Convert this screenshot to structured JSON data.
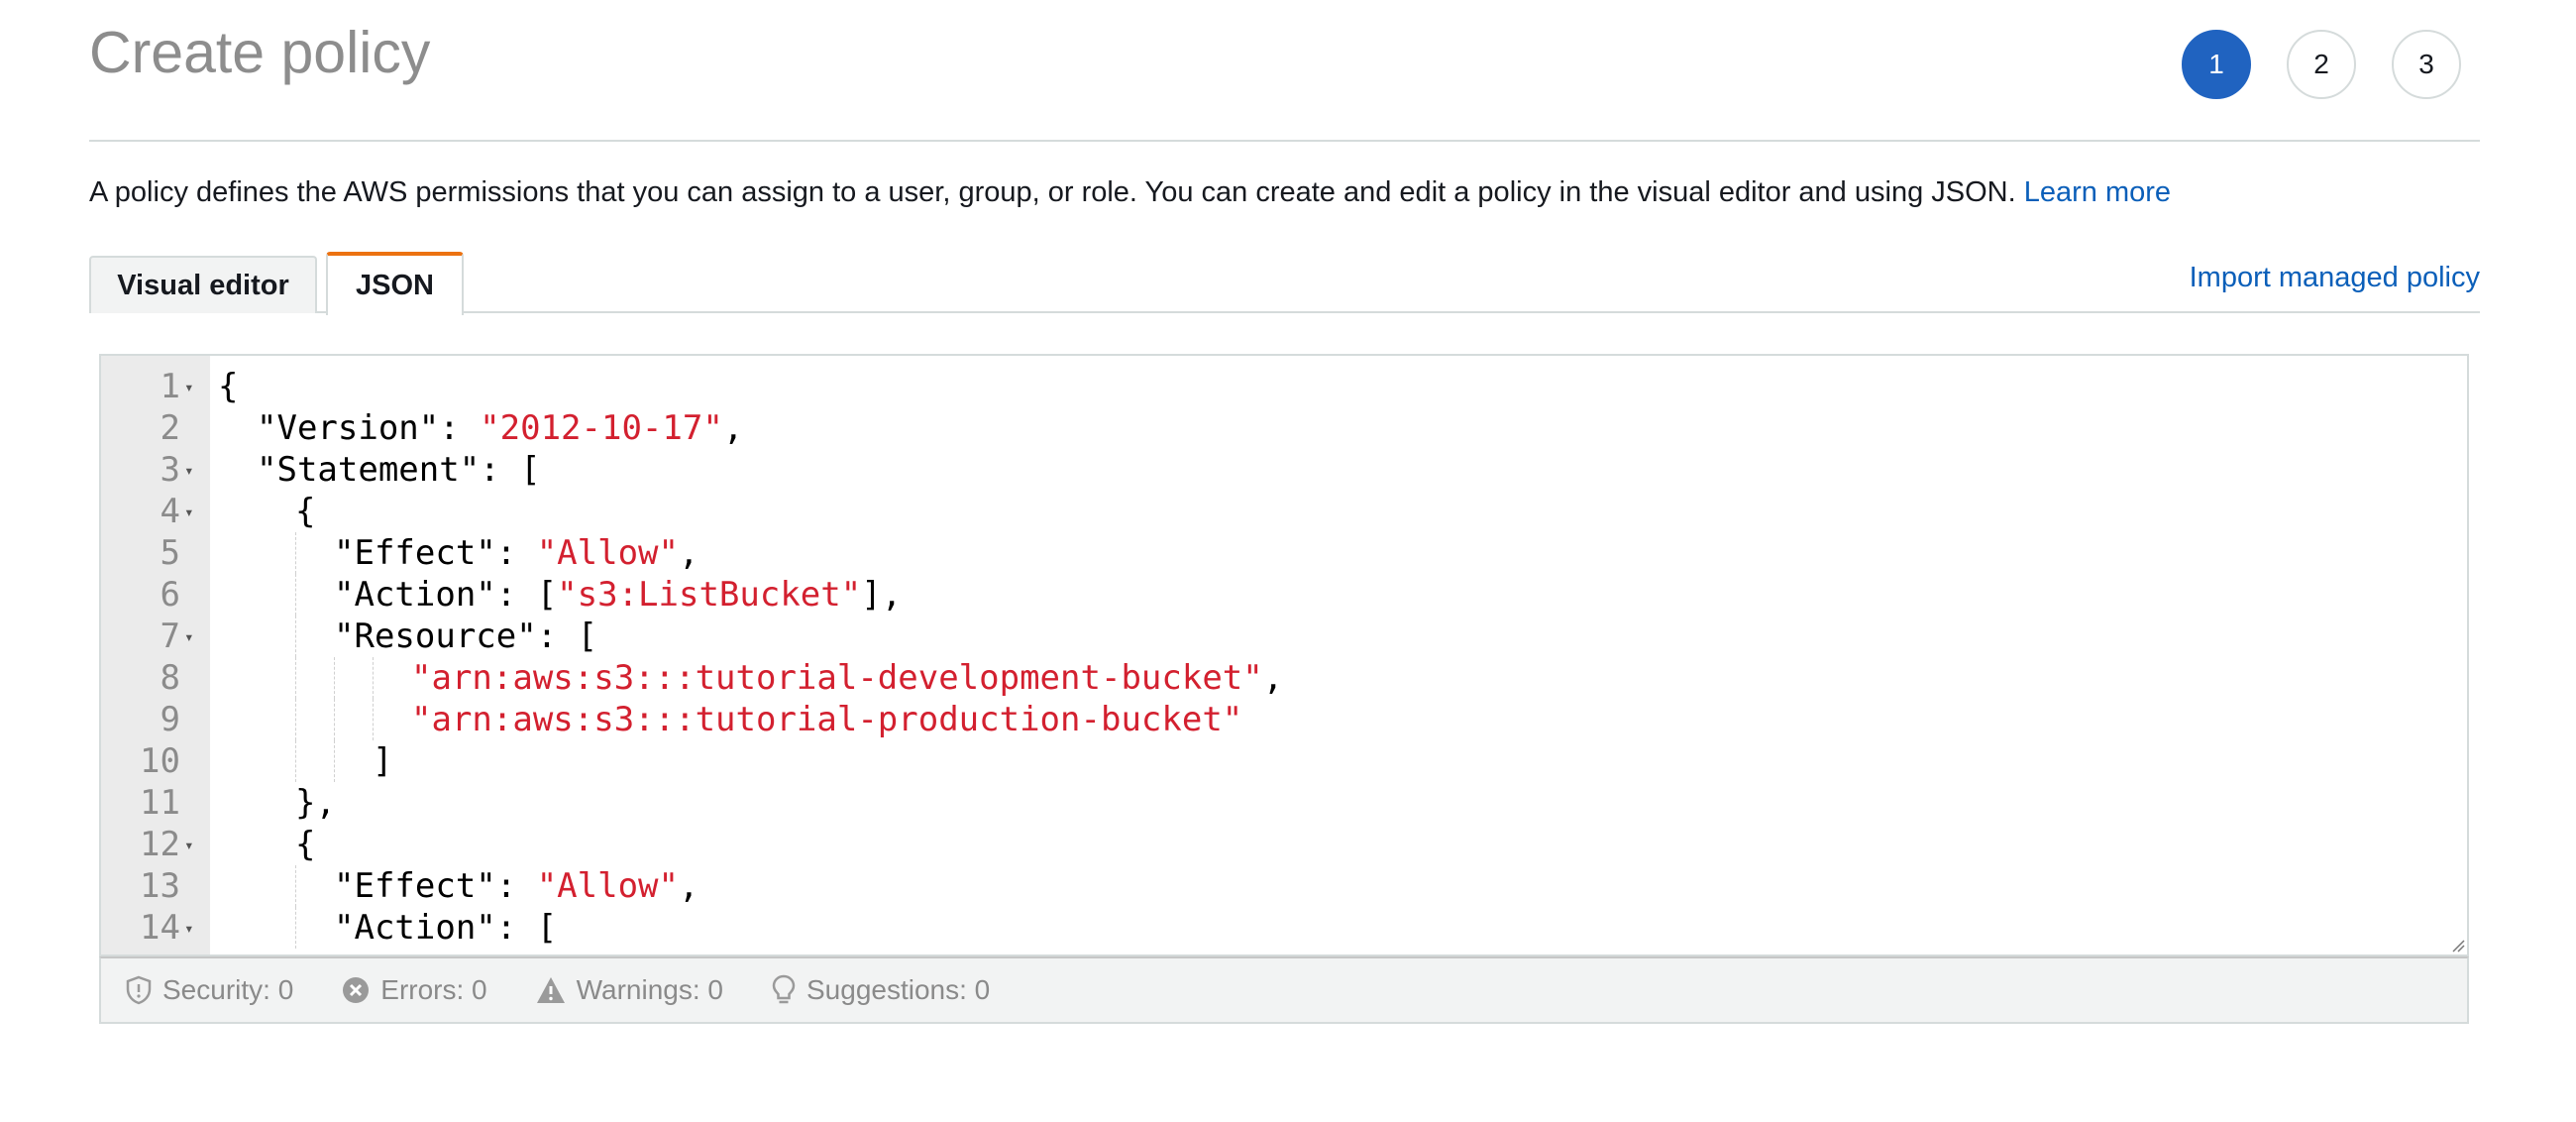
{
  "page": {
    "title": "Create policy",
    "steps": [
      "1",
      "2",
      "3"
    ],
    "active_step": "1"
  },
  "description": {
    "text": "A policy defines the AWS permissions that you can assign to a user, group, or role. You can create and edit a policy in the visual editor and using JSON. ",
    "learn_more": "Learn more"
  },
  "tabs": {
    "visual_editor": "Visual editor",
    "json": "JSON",
    "active": "JSON"
  },
  "import_link": "Import managed policy",
  "editor": {
    "lines": [
      {
        "n": "1",
        "fold": true,
        "indent": 0,
        "parts": [
          {
            "t": "{",
            "s": false
          }
        ]
      },
      {
        "n": "2",
        "fold": false,
        "indent": 1,
        "parts": [
          {
            "t": "\"Version\": ",
            "s": false
          },
          {
            "t": "\"2012-10-17\"",
            "s": true
          },
          {
            "t": ",",
            "s": false
          }
        ]
      },
      {
        "n": "3",
        "fold": true,
        "indent": 1,
        "parts": [
          {
            "t": "\"Statement\": [",
            "s": false
          }
        ]
      },
      {
        "n": "4",
        "fold": true,
        "indent": 2,
        "parts": [
          {
            "t": "{",
            "s": false
          }
        ]
      },
      {
        "n": "5",
        "fold": false,
        "indent": 3,
        "parts": [
          {
            "t": "\"Effect\": ",
            "s": false
          },
          {
            "t": "\"Allow\"",
            "s": true
          },
          {
            "t": ",",
            "s": false
          }
        ]
      },
      {
        "n": "6",
        "fold": false,
        "indent": 3,
        "parts": [
          {
            "t": "\"Action\": [",
            "s": false
          },
          {
            "t": "\"s3:ListBucket\"",
            "s": true
          },
          {
            "t": "],",
            "s": false
          }
        ]
      },
      {
        "n": "7",
        "fold": true,
        "indent": 3,
        "parts": [
          {
            "t": "\"Resource\": [",
            "s": false
          }
        ]
      },
      {
        "n": "8",
        "fold": false,
        "indent": 5,
        "parts": [
          {
            "t": "\"arn:aws:s3:::tutorial-development-bucket\"",
            "s": true
          },
          {
            "t": ",",
            "s": false
          }
        ]
      },
      {
        "n": "9",
        "fold": false,
        "indent": 5,
        "parts": [
          {
            "t": "\"arn:aws:s3:::tutorial-production-bucket\"",
            "s": true
          }
        ]
      },
      {
        "n": "10",
        "fold": false,
        "indent": 4,
        "parts": [
          {
            "t": "]",
            "s": false
          }
        ]
      },
      {
        "n": "11",
        "fold": false,
        "indent": 2,
        "parts": [
          {
            "t": "},",
            "s": false
          }
        ]
      },
      {
        "n": "12",
        "fold": true,
        "indent": 2,
        "parts": [
          {
            "t": "{",
            "s": false
          }
        ]
      },
      {
        "n": "13",
        "fold": false,
        "indent": 3,
        "parts": [
          {
            "t": "\"Effect\": ",
            "s": false
          },
          {
            "t": "\"Allow\"",
            "s": true
          },
          {
            "t": ",",
            "s": false
          }
        ]
      },
      {
        "n": "14",
        "fold": true,
        "indent": 3,
        "parts": [
          {
            "t": "\"Action\": [",
            "s": false
          }
        ]
      }
    ]
  },
  "status": {
    "security": "Security: 0",
    "errors": "Errors: 0",
    "warnings": "Warnings: 0",
    "suggestions": "Suggestions: 0"
  },
  "colors": {
    "primary": "#2063c0",
    "link": "#0b5fb9",
    "tab_accent": "#ec7211",
    "string": "#d3202f"
  },
  "icons": {
    "security": "shield-icon",
    "errors": "error-circle-icon",
    "warnings": "warning-triangle-icon",
    "suggestions": "lightbulb-icon",
    "fold": "fold-arrow-icon",
    "resize": "resize-grip-icon"
  }
}
